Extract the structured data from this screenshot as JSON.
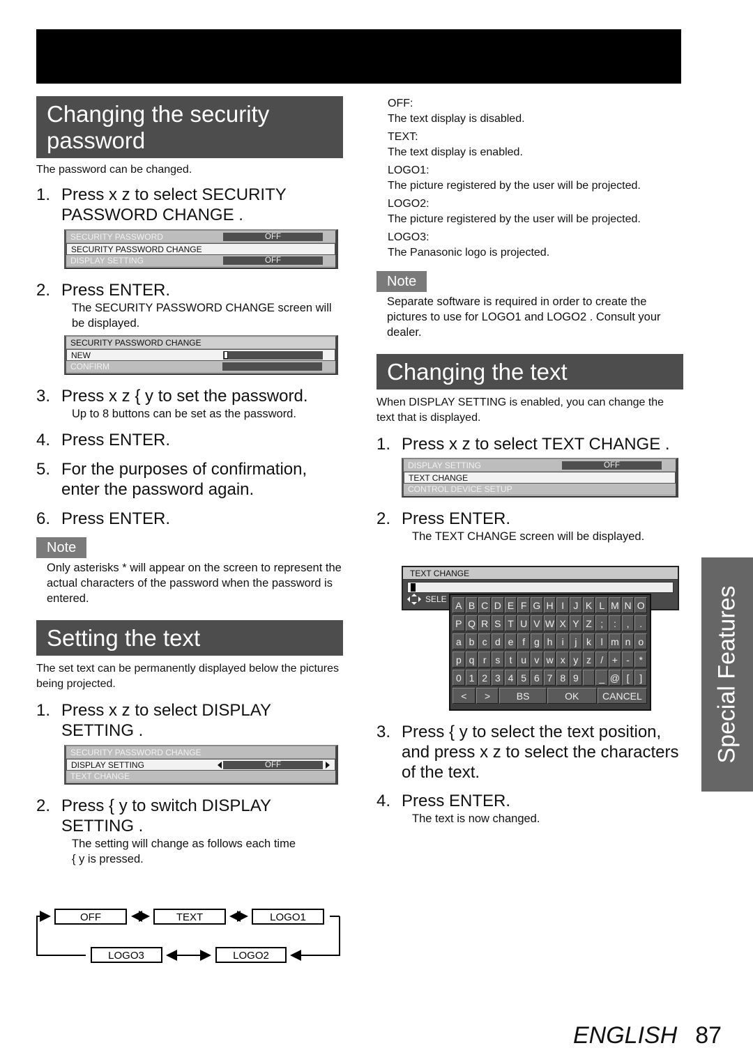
{
  "security": {
    "title_line1": "Changing the security",
    "title_line2": "password",
    "intro": "The password can be changed.",
    "step1": {
      "num": "1.",
      "text": "Press  x z  to select  SECURITY PASSWORD CHANGE ."
    },
    "menu1": {
      "rows": [
        {
          "label": "SECURITY PASSWORD",
          "value": "OFF"
        },
        {
          "label": "SECURITY PASSWORD CHANGE",
          "value": ""
        },
        {
          "label": "DISPLAY SETTING",
          "value": "OFF"
        }
      ]
    },
    "step2": {
      "num": "2.",
      "text": "Press ENTER.",
      "sub": "The  SECURITY PASSWORD CHANGE  screen will be displayed."
    },
    "menu2": {
      "title": "SECURITY PASSWORD CHANGE",
      "rows": [
        {
          "label": "NEW"
        },
        {
          "label": "CONFIRM"
        }
      ]
    },
    "step3": {
      "num": "3.",
      "text": "Press  x z { y    to set the password.",
      "sub": "Up to 8 buttons can be set as the password."
    },
    "step4": {
      "num": "4.",
      "text": "Press ENTER."
    },
    "step5": {
      "num": "5.",
      "text": "For the purposes of confirmation, enter the password again."
    },
    "step6": {
      "num": "6.",
      "text": "Press ENTER."
    },
    "note_label": "Note",
    "note": "Only asterisks * will appear on the screen to represent the actual characters of the password when the password is entered."
  },
  "setting": {
    "title": "Setting the text",
    "intro": "The set text can be permanently displayed below the pictures being projected.",
    "step1": {
      "num": "1.",
      "text": "Press  x z  to select  DISPLAY SETTING ."
    },
    "menu": {
      "rows": [
        {
          "label": "SECURITY PASSWORD CHANGE"
        },
        {
          "label": "DISPLAY SETTING",
          "value": "OFF"
        },
        {
          "label": "TEXT CHANGE"
        }
      ]
    },
    "step2": {
      "num": "2.",
      "text": "Press  { y  to switch  DISPLAY SETTING .",
      "sub1": "The setting will change as follows each time",
      "sub2": "{ y   is pressed."
    },
    "cycle": [
      "OFF",
      "TEXT",
      "LOGO1",
      "LOGO2",
      "LOGO3"
    ]
  },
  "options": [
    {
      "term": "OFF:",
      "desc": "The text display is disabled."
    },
    {
      "term": "TEXT:",
      "desc": "The text display is enabled."
    },
    {
      "term": "LOGO1:",
      "desc": "The picture registered by the user will be projected."
    },
    {
      "term": "LOGO2:",
      "desc": "The picture registered by the user will be projected."
    },
    {
      "term": "LOGO3:",
      "desc": "The Panasonic logo is projected."
    }
  ],
  "note2": {
    "label": "Note",
    "text": "Separate software is required in order to create the pictures to use for  LOGO1  and  LOGO2 . Consult your dealer."
  },
  "changing": {
    "title": "Changing the text",
    "intro": "When DISPLAY SETTING is enabled, you can change the text that is displayed.",
    "step1": {
      "num": "1.",
      "text": "Press  x z  to select  TEXT CHANGE ."
    },
    "menu": {
      "rows": [
        {
          "label": "DISPLAY SETTING",
          "value": "OFF"
        },
        {
          "label": "TEXT CHANGE"
        },
        {
          "label": "CONTROL DEVICE SETUP"
        }
      ]
    },
    "step2": {
      "num": "2.",
      "text": "Press ENTER.",
      "sub": "The  TEXT CHANGE  screen will be displayed."
    },
    "keyboard": {
      "title": "TEXT CHANGE",
      "select_label": "SELE",
      "rows": [
        [
          "A",
          "B",
          "C",
          "D",
          "E",
          "F",
          "G",
          "H",
          "I",
          "J",
          "K",
          "L",
          "M",
          "N",
          "O"
        ],
        [
          "P",
          "Q",
          "R",
          "S",
          "T",
          "U",
          "V",
          "W",
          "X",
          "Y",
          "Z",
          ";",
          ":",
          ",",
          "."
        ],
        [
          "a",
          "b",
          "c",
          "d",
          "e",
          "f",
          "g",
          "h",
          "i",
          "j",
          "k",
          "l",
          "m",
          "n",
          "o"
        ],
        [
          "p",
          "q",
          "r",
          "s",
          "t",
          "u",
          "v",
          "w",
          "x",
          "y",
          "z",
          "/",
          "+",
          "-",
          "*"
        ],
        [
          "0",
          "1",
          "2",
          "3",
          "4",
          "5",
          "6",
          "7",
          "8",
          "9",
          " ",
          "_",
          "@",
          "[",
          "]"
        ]
      ],
      "controls": [
        "<",
        ">",
        "BS",
        "OK",
        "CANCEL"
      ]
    },
    "step3": {
      "num": "3.",
      "text": "Press  { y  to select the text position, and press   x z  to select the characters of the text."
    },
    "step4": {
      "num": "4.",
      "text": "Press ENTER.",
      "sub": "The text is now changed."
    }
  },
  "side_tab": "Special Features",
  "footer": {
    "language": "ENGLISH",
    "page": "87"
  }
}
